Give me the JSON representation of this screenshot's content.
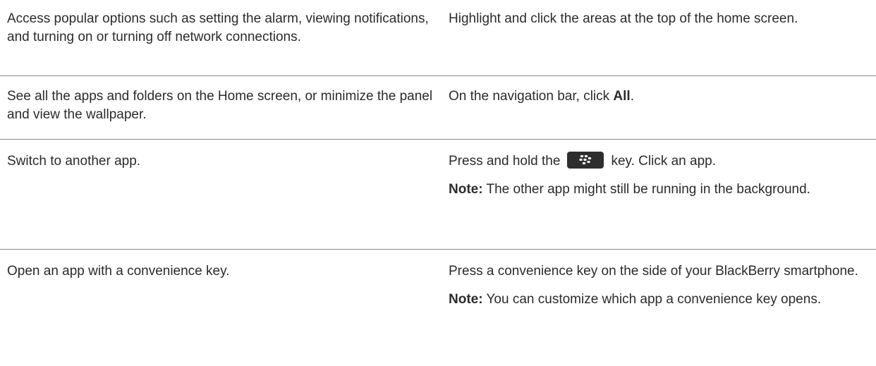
{
  "rows": [
    {
      "task": "Access popular options such as setting the alarm, viewing notifications, and turning on or turning off network connections.",
      "action": "Highlight and click the areas at the top of the home screen."
    },
    {
      "task": "See all the apps and folders on the Home screen, or minimize the panel and view the wallpaper.",
      "action_before": "On the navigation bar, click ",
      "action_bold": "All",
      "action_after": "."
    },
    {
      "task": "Switch to another app.",
      "action_before": "Press and hold the",
      "key_icon": "blackberry-key-icon",
      "action_after": "key. Click an app.",
      "note_label": "Note:",
      "note_text": " The other app might still be running in the background."
    },
    {
      "task": "Open an app with a convenience key.",
      "action": "Press a convenience key on the side of your BlackBerry smartphone.",
      "note_label": "Note:",
      "note_text": " You can customize which app a convenience key opens."
    }
  ]
}
